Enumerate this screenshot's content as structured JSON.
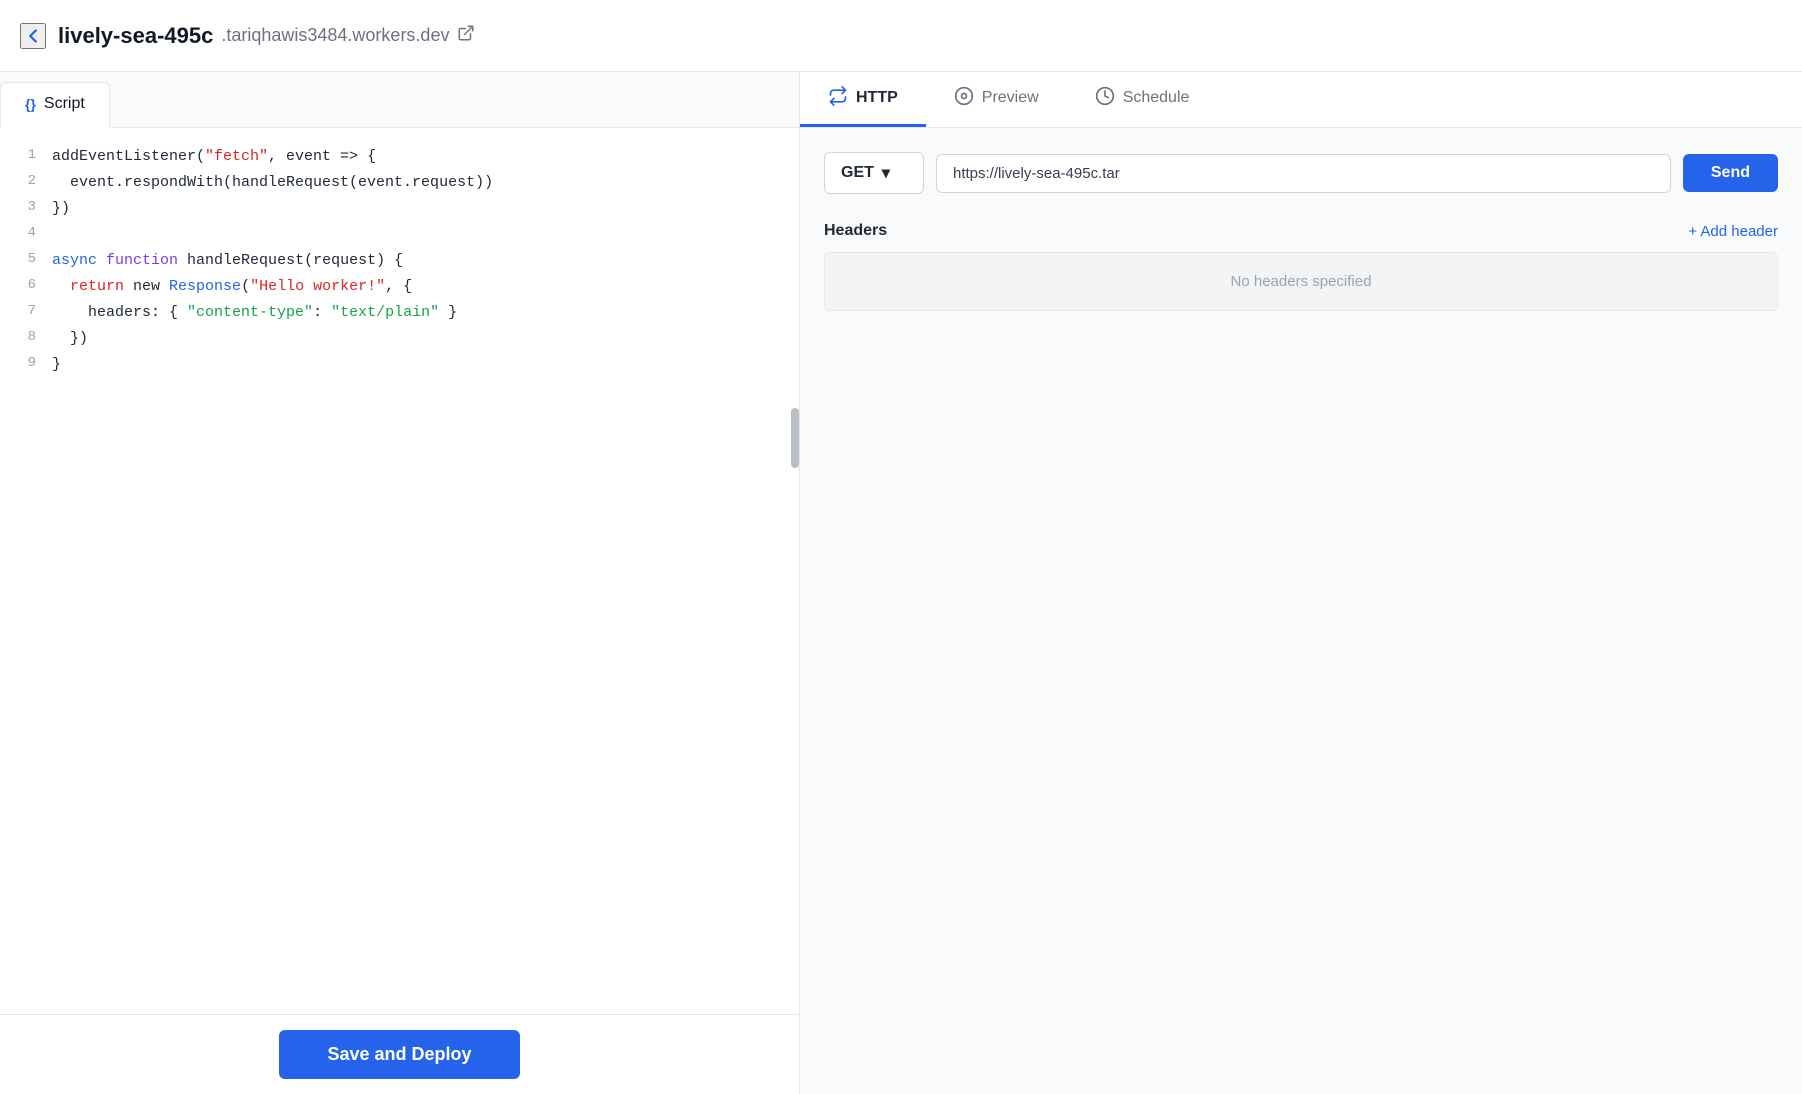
{
  "topbar": {
    "back_label": "←",
    "title": "lively-sea-495c",
    "domain": ".tariqhawis3484.workers.dev",
    "external_link": "↗"
  },
  "editor": {
    "tab_icon": "{}",
    "tab_label": "Script",
    "lines": [
      {
        "num": "1",
        "tokens": [
          {
            "text": "addEventListener(",
            "class": ""
          },
          {
            "text": "\"fetch\"",
            "class": "str-red"
          },
          {
            "text": ", event => {",
            "class": ""
          }
        ]
      },
      {
        "num": "2",
        "tokens": [
          {
            "text": "  event.respondWith(handleRequest(event.request))",
            "class": ""
          }
        ]
      },
      {
        "num": "3",
        "tokens": [
          {
            "text": "})",
            "class": ""
          }
        ]
      },
      {
        "num": "4",
        "tokens": [
          {
            "text": "",
            "class": ""
          }
        ]
      },
      {
        "num": "5",
        "tokens": [
          {
            "text": "async ",
            "class": "kw-blue"
          },
          {
            "text": "function ",
            "class": "kw-purple"
          },
          {
            "text": "handleRequest(request) {",
            "class": ""
          }
        ]
      },
      {
        "num": "6",
        "tokens": [
          {
            "text": "  ",
            "class": ""
          },
          {
            "text": "return",
            "class": "kw-red"
          },
          {
            "text": " new ",
            "class": ""
          },
          {
            "text": "Response",
            "class": "kw-blue"
          },
          {
            "text": "(",
            "class": ""
          },
          {
            "text": "\"Hello worker!\"",
            "class": "str-red"
          },
          {
            "text": ", {",
            "class": ""
          }
        ]
      },
      {
        "num": "7",
        "tokens": [
          {
            "text": "    headers: { ",
            "class": ""
          },
          {
            "text": "\"content-type\"",
            "class": "kw-green"
          },
          {
            "text": ": ",
            "class": ""
          },
          {
            "text": "\"text/plain\"",
            "class": "str-green"
          },
          {
            "text": " }",
            "class": ""
          }
        ]
      },
      {
        "num": "8",
        "tokens": [
          {
            "text": "  })",
            "class": ""
          }
        ]
      },
      {
        "num": "9",
        "tokens": [
          {
            "text": "}",
            "class": ""
          }
        ]
      }
    ]
  },
  "save_deploy_label": "Save and Deploy",
  "http_panel": {
    "tabs": [
      {
        "label": "HTTP",
        "icon": "⇄",
        "active": true
      },
      {
        "label": "Preview",
        "icon": "◎",
        "active": false
      },
      {
        "label": "Schedule",
        "icon": "○",
        "active": false
      }
    ],
    "method": "GET",
    "url": "https://lively-sea-495c.tar",
    "send_label": "Send",
    "headers_title": "Headers",
    "add_header_label": "+ Add header",
    "no_headers_text": "No headers specified"
  }
}
